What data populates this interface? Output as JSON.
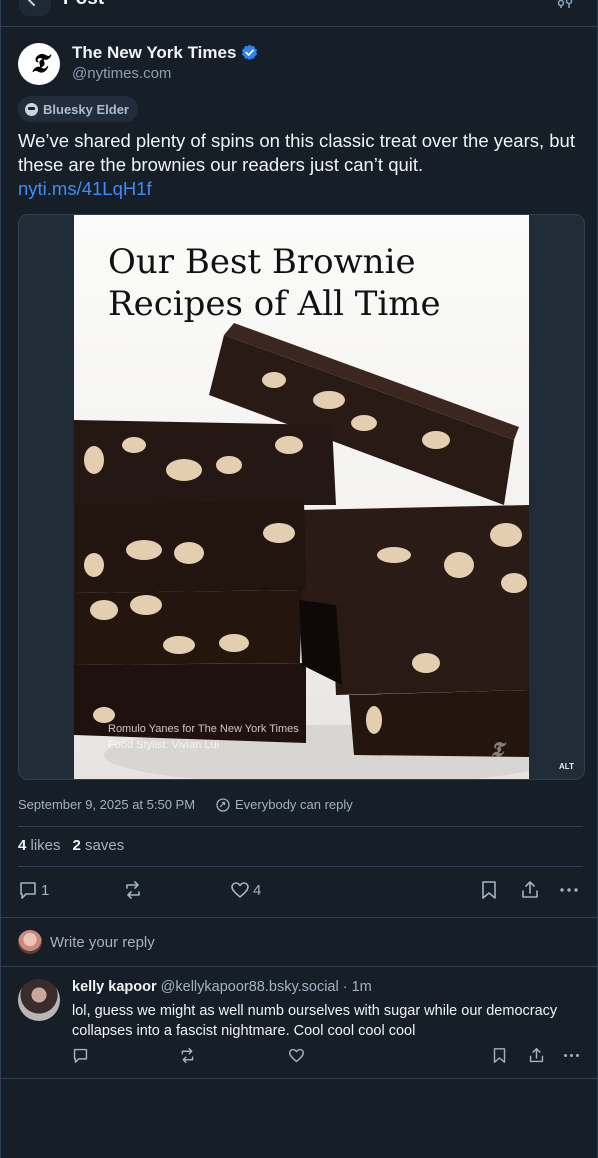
{
  "header": {
    "title": "Post",
    "back_icon": "arrow-left-icon",
    "settings_icon": "sliders-icon"
  },
  "post": {
    "author": {
      "name": "The New York Times",
      "handle": "@nytimes.com",
      "verified": true,
      "avatar_glyph": "𝕿"
    },
    "badge": "Bluesky Elder",
    "text": "We’ve shared plenty of spins on this classic treat over the years, but these are the brownies our readers just can’t quit.",
    "link": "nyti.ms/41LqH1f",
    "image": {
      "title": "Our Best Brownie Recipes of All Time",
      "credit_line1": "Romulo Yanes for The New York Times",
      "credit_line2": "Food Stylist: Vivian Lui",
      "mark": "𝕿",
      "alt_label": "ALT"
    },
    "timestamp": "September 9, 2025 at 5:50 PM",
    "reply_permission": "Everybody can reply",
    "likes_count": "4",
    "likes_label": "likes",
    "saves_count": "2",
    "saves_label": "saves",
    "actions": {
      "replies": "1",
      "reposts": "",
      "likes": "4"
    }
  },
  "composer": {
    "placeholder": "Write your reply"
  },
  "reply": {
    "name": "kelly kapoor",
    "handle": "@kellykapoor88.bsky.social",
    "time": "· 1m",
    "text": "lol, guess we might as well numb ourselves with sugar while our democracy collapses into a fascist nightmare. Cool cool cool cool"
  },
  "colors": {
    "background": "#161e27",
    "link": "#3d8ef4",
    "verified": "#2f84f5",
    "muted": "#a3b2c2"
  }
}
